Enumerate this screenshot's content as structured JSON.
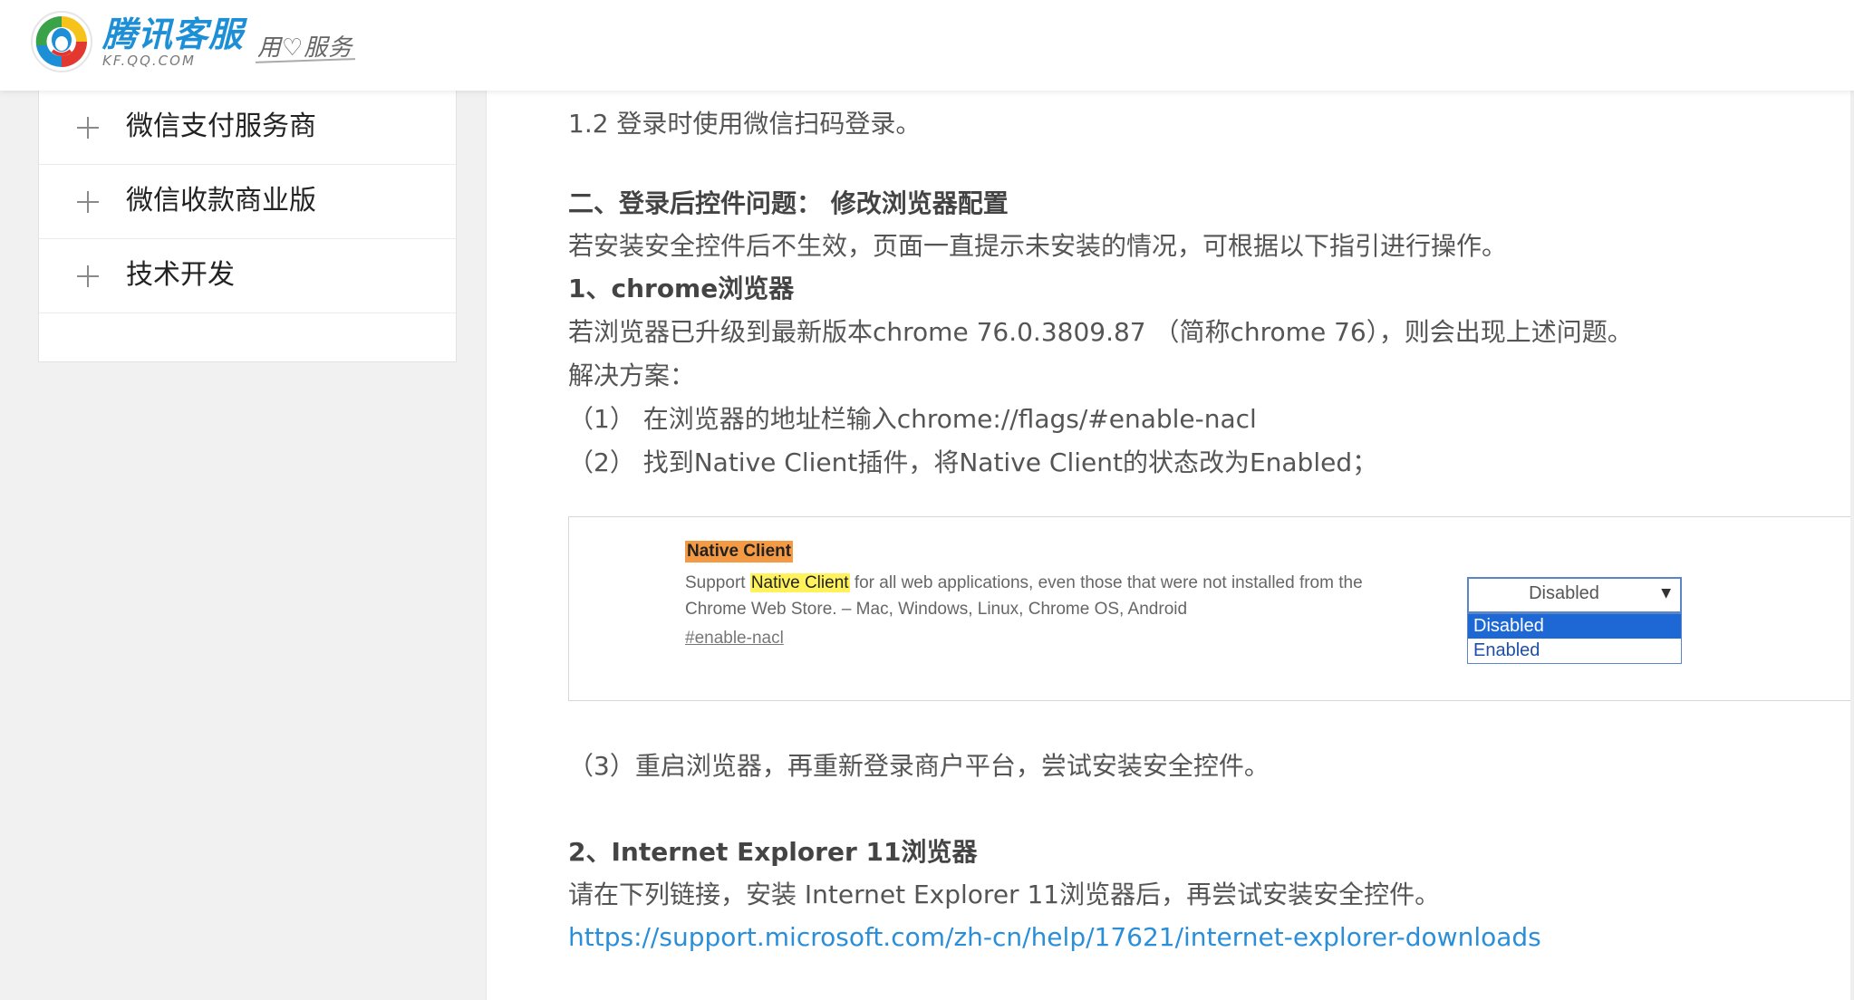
{
  "header": {
    "logo_text": "腾讯客服",
    "logo_sub": "KF.QQ.COM",
    "slogan": "用♡服务"
  },
  "sidebar": {
    "items": [
      {
        "label": "微信支付服务商"
      },
      {
        "label": "微信收款商业版"
      },
      {
        "label": "技术开发"
      }
    ]
  },
  "content": {
    "line_1_2": "1.2 登录时使用微信扫码登录。",
    "section_2_title": "二、登录后控件问题： 修改浏览器配置",
    "section_2_intro": "若安装安全控件后不生效，页面一直提示未安装的情况，可根据以下指引进行操作。",
    "chrome_title": "1、chrome浏览器",
    "chrome_desc": "若浏览器已升级到最新版本chrome 76.0.3809.87 （简称chrome 76），则会出现上述问题。",
    "solution_label": "解决方案：",
    "step1": "（1）    在浏览器的地址栏输入chrome://flags/#enable-nacl",
    "step2": "（2）    找到Native Client插件，将Native Client的状态改为Enabled；",
    "step3": "（3）重启浏览器，再重新登录商户平台，尝试安装安全控件。",
    "ie_title": "2、Internet Explorer 11浏览器",
    "ie_desc": "请在下列链接，安装 Internet Explorer 11浏览器后，再尝试安装安全控件。",
    "ie_link": "https://support.microsoft.com/zh-cn/help/17621/internet-explorer-downloads"
  },
  "flag_screenshot": {
    "title": "Native Client",
    "desc_prefix": "Support ",
    "desc_highlight": "Native Client",
    "desc_suffix": " for all web applications, even those that were not installed from the Chrome Web Store. – Mac, Windows, Linux, Chrome OS, Android",
    "flag": "#enable-nacl",
    "dropdown_selected": "Disabled",
    "options": [
      "Disabled",
      "Enabled"
    ]
  },
  "colors": {
    "link": "#2a8fd8",
    "brand": "#1d8fd6",
    "title_highlight": "#f49a45",
    "text_highlight": "#fff25a",
    "option_active": "#1e68d6"
  }
}
